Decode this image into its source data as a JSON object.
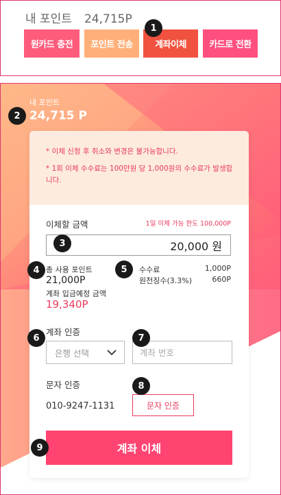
{
  "top": {
    "points_label": "내 포인트",
    "points_value": "24,715P",
    "buttons": [
      {
        "label": "원카드 충전",
        "color": "#ff5c7c"
      },
      {
        "label": "포인트 전송",
        "color": "#ffb07a"
      },
      {
        "label": "계좌이체",
        "color": "#f0523f"
      },
      {
        "label": "카드로 전환",
        "color": "#ff4f7f"
      }
    ]
  },
  "markers": [
    "1",
    "2",
    "3",
    "4",
    "5",
    "6",
    "7",
    "8",
    "9"
  ],
  "main": {
    "points_label": "내 포인트",
    "points_value": "24,715 P",
    "notices": [
      "* 이체 신청 후 취소와 변경은 불가능합니다.",
      "* 1회 이체 수수료는 100만원 당 1,000원의 수수료가 발생합니다."
    ],
    "amount_label": "이체할 금액",
    "limit_text": "1일 이체 가능 한도 100,000P",
    "amount_value": "20,000 원",
    "total_used_label": "총 사용 포인트",
    "total_used_value": "21,000P",
    "deposit_label": "계좌 입금예정 금액",
    "deposit_value": "19,340P",
    "fee_label": "수수료",
    "fee_value": "1,000P",
    "tax_label": "원천징수(3.3%)",
    "tax_value": "660P",
    "account_auth_label": "계좌 인증",
    "bank_select_placeholder": "은행 선택",
    "account_number_placeholder": "계좌 번호",
    "sms_auth_label": "문자 인증",
    "phone_number": "010-9247-1131",
    "sms_button_label": "문자 인증",
    "submit_label": "계좌 이체"
  },
  "colors": {
    "accent": "#e8395a",
    "submit": "#ff4471",
    "border": "#e0336c"
  }
}
